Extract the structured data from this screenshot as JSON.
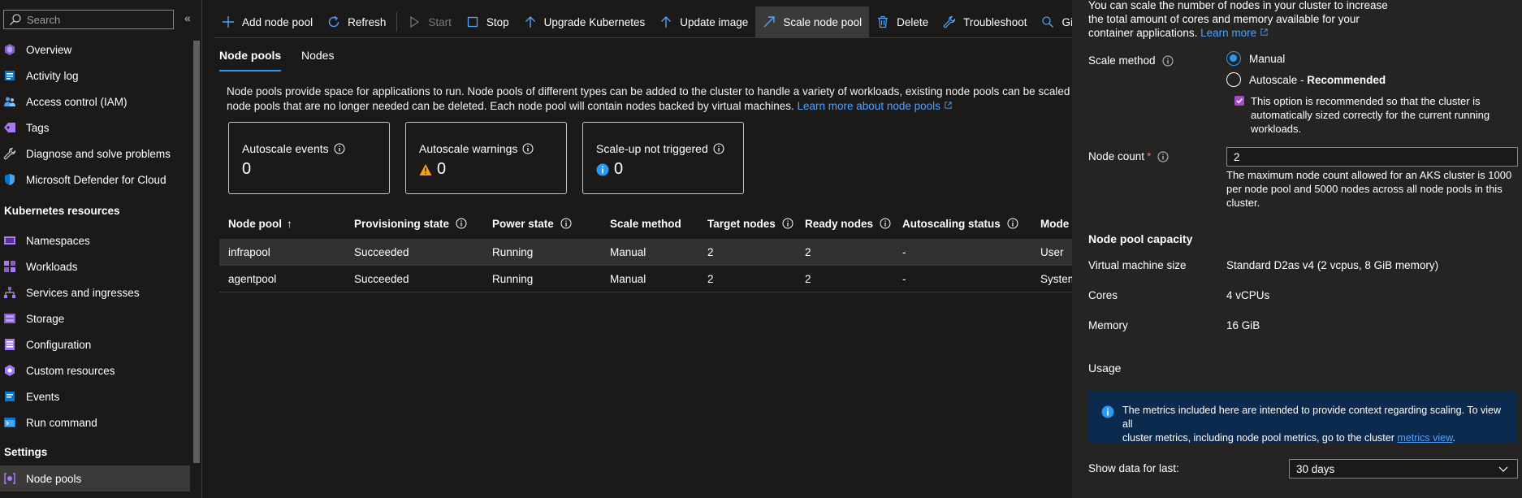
{
  "sidebar": {
    "search_placeholder": "Search",
    "collapse_glyph": "«",
    "items": [
      {
        "label": "Overview",
        "icon": "overview-icon"
      },
      {
        "label": "Activity log",
        "icon": "activity-log-icon"
      },
      {
        "label": "Access control (IAM)",
        "icon": "people-icon"
      },
      {
        "label": "Tags",
        "icon": "tag-icon"
      },
      {
        "label": "Diagnose and solve problems",
        "icon": "wrench-icon"
      },
      {
        "label": "Microsoft Defender for Cloud",
        "icon": "shield-icon"
      }
    ],
    "section_kubernetes": "Kubernetes resources",
    "k8s_items": [
      {
        "label": "Namespaces",
        "icon": "namespaces-icon"
      },
      {
        "label": "Workloads",
        "icon": "workloads-icon"
      },
      {
        "label": "Services and ingresses",
        "icon": "services-icon"
      },
      {
        "label": "Storage",
        "icon": "storage-icon"
      },
      {
        "label": "Configuration",
        "icon": "configuration-icon"
      },
      {
        "label": "Custom resources",
        "icon": "custom-resources-icon"
      },
      {
        "label": "Events",
        "icon": "events-icon"
      },
      {
        "label": "Run command",
        "icon": "run-command-icon"
      }
    ],
    "section_settings": "Settings",
    "settings_items": [
      {
        "label": "Node pools",
        "icon": "node-pools-icon",
        "active": true
      }
    ]
  },
  "toolbar": {
    "add_node_pool": "Add node pool",
    "refresh": "Refresh",
    "start": "Start",
    "stop": "Stop",
    "upgrade_kubernetes": "Upgrade Kubernetes",
    "update_image": "Update image",
    "scale_node_pool": "Scale node pool",
    "delete": "Delete",
    "troubleshoot": "Troubleshoot",
    "give_feedback": "Give feedba"
  },
  "tabs": {
    "node_pools": "Node pools",
    "nodes": "Nodes"
  },
  "description": {
    "line1": "Node pools provide space for applications to run. Node pools of different types can be added to the cluster to handle a variety of workloads, existing node pools can be scaled and up",
    "line2": "node pools that are no longer needed can be deleted. Each node pool will contain nodes backed by virtual machines.",
    "link": "Learn more about node pools"
  },
  "cards": [
    {
      "title": "Autoscale events",
      "value": "0"
    },
    {
      "title": "Autoscale warnings",
      "value": "0"
    },
    {
      "title": "Scale-up not triggered",
      "value": "0"
    }
  ],
  "table": {
    "headers": {
      "node_pool": "Node pool",
      "sort_glyph": "↑",
      "provisioning_state": "Provisioning state",
      "power_state": "Power state",
      "scale_method": "Scale method",
      "target_nodes": "Target nodes",
      "ready_nodes": "Ready nodes",
      "autoscaling_status": "Autoscaling status",
      "mode": "Mode"
    },
    "rows": [
      {
        "node_pool": "infrapool",
        "provisioning_state": "Succeeded",
        "power_state": "Running",
        "scale_method": "Manual",
        "target_nodes": "2",
        "ready_nodes": "2",
        "autoscaling_status": "-",
        "mode": "User"
      },
      {
        "node_pool": "agentpool",
        "provisioning_state": "Succeeded",
        "power_state": "Running",
        "scale_method": "Manual",
        "target_nodes": "2",
        "ready_nodes": "2",
        "autoscaling_status": "-",
        "mode": "System"
      }
    ]
  },
  "panel": {
    "intro_line1": "You can scale the number of nodes in your cluster to increase",
    "intro_line2": "the total amount of cores and memory available for your",
    "intro_line3": "container applications.",
    "intro_link": "Learn more",
    "scale_method_label": "Scale method",
    "option_manual": "Manual",
    "option_autoscale": "Autoscale - ",
    "option_autoscale_bold": "Recommended",
    "recommend_line1": "This option is recommended so that the cluster is",
    "recommend_line2": "automatically sized correctly for the current running",
    "recommend_line3": "workloads.",
    "node_count_label": "Node count",
    "required_mark": "*",
    "node_count_value": "2",
    "node_count_help_line1": "The maximum node count allowed for an AKS cluster is 1000",
    "node_count_help_line2": "per node pool and 5000 nodes across all node pools in this",
    "node_count_help_line3": "cluster.",
    "capacity_heading": "Node pool capacity",
    "vm_size_label": "Virtual machine size",
    "vm_size_value": "Standard D2as v4 (2 vcpus, 8 GiB memory)",
    "cores_label": "Cores",
    "cores_value": "4 vCPUs",
    "memory_label": "Memory",
    "memory_value": "16 GiB",
    "usage_label": "Usage",
    "info_line1": "The metrics included here are intended to provide context regarding scaling. To view all",
    "info_line2": "cluster metrics, including node pool metrics, go to the cluster",
    "info_link": "metrics view",
    "info_end": ".",
    "show_data_label": "Show data for last:",
    "range_value": "30 days"
  },
  "colors": {
    "accent": "#2899f5",
    "link": "#4da3ff",
    "background": "#1b1a19",
    "panel": "#252423",
    "warning": "#f7a10e"
  }
}
